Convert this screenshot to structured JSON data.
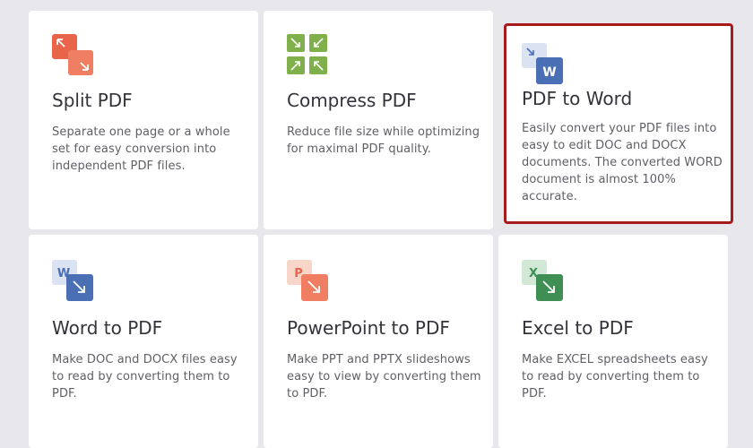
{
  "tools": [
    {
      "key": "split",
      "title": "Split PDF",
      "description": "Separate one page or a whole set for easy conversion into independent PDF files.",
      "icon": "split-pdf-icon",
      "color": "#e8644a"
    },
    {
      "key": "compress",
      "title": "Compress PDF",
      "description": "Reduce file size while optimizing for maximal PDF quality.",
      "icon": "compress-pdf-icon",
      "color": "#7fb04c"
    },
    {
      "key": "pdf-to-word",
      "title": "PDF to Word",
      "description": "Easily convert your PDF files into easy to edit DOC and DOCX documents. The converted WORD document is almost 100% accurate.",
      "icon": "pdf-to-word-icon",
      "color": "#4a6fb5",
      "highlighted": true,
      "glyph": "W"
    },
    {
      "key": "word-to-pdf",
      "title": "Word to PDF",
      "description": "Make DOC and DOCX files easy to read by converting them to PDF.",
      "icon": "word-to-pdf-icon",
      "color": "#4a6fb5",
      "glyph": "W"
    },
    {
      "key": "ppt-to-pdf",
      "title": "PowerPoint to PDF",
      "description": "Make PPT and PPTX slideshows easy to view by converting them to PDF.",
      "icon": "powerpoint-to-pdf-icon",
      "color": "#e8644a",
      "glyph": "P"
    },
    {
      "key": "excel-to-pdf",
      "title": "Excel to PDF",
      "description": "Make EXCEL spreadsheets easy to read by converting them to PDF.",
      "icon": "excel-to-pdf-icon",
      "color": "#3f8f55",
      "glyph": "X"
    }
  ],
  "colors": {
    "highlight_border": "#a61c1c",
    "page_bg": "#e8e8ec"
  }
}
